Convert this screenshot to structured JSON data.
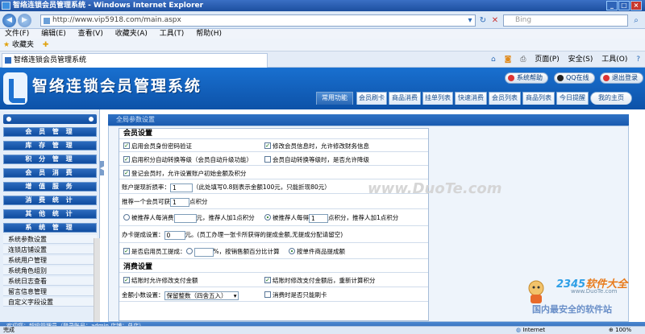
{
  "window": {
    "title": "智络连锁会员管理系统 - Windows Internet Explorer",
    "controls": [
      "_",
      "□",
      "×"
    ]
  },
  "addressbar": {
    "url": "http://www.vip5918.com/main.aspx",
    "search_placeholder": "Bing"
  },
  "menubar": {
    "items": [
      "文件(F)",
      "编辑(E)",
      "查看(V)",
      "收藏夹(A)",
      "工具(T)",
      "帮助(H)"
    ]
  },
  "favbar": {
    "label": "收藏夹"
  },
  "tab": {
    "label": "智络连锁会员管理系统"
  },
  "tabtools": {
    "items": [
      "页面(P)",
      "安全(S)",
      "工具(O)"
    ]
  },
  "app": {
    "title": "智络连锁会员管理系统"
  },
  "topbuttons": [
    "系统帮助",
    "QQ在线",
    "退出登录"
  ],
  "navtabs": {
    "items": [
      "常用功能",
      "会员刷卡",
      "商品消费",
      "挂单列表",
      "快速消费",
      "会员列表",
      "商品列表",
      "今日提醒",
      "我的主页"
    ],
    "active": 0
  },
  "sidebar": {
    "menus": [
      "会 员 管 理",
      "库 存 管 理",
      "积 分 管 理",
      "会 员 消 费",
      "增 值 服 务",
      "消 费 统 计",
      "其 他 统 计",
      "系 统 管 理"
    ],
    "subitems": [
      "系统参数设置",
      "连锁店铺设置",
      "系统用户管理",
      "系统角色组别",
      "系统日志查看",
      "留言信息管理",
      "自定义字段设置"
    ]
  },
  "main": {
    "header": "全局参数设置",
    "member_section": "会员设置",
    "r1a": "启用会员身份密码验证",
    "r1b": "修改会员信息时，允许修改财务信息",
    "r2a": "启用积分自动转换等级（会员自动升级功能）",
    "r2b": "会员自动转换等级时，是否允许降级",
    "r3": "登记会员时，允许设置账户初始金额及积分",
    "r4_label": "账户提现折损率：",
    "r4_value": "1",
    "r4_hint": "（此处填写0.8则表示金额100元，只能折现80元）",
    "r5_label": "推荐一个会员可获",
    "r5_value": "1",
    "r5_suffix": "点积分",
    "r6a_label": "被推荐人每消费",
    "r6a_suffix": "元，推荐人加1点积分",
    "r6b_label": "被推荐人每得",
    "r6b_value": "1",
    "r6b_suffix": "点积分，推荐人加1点积分",
    "r7_label": "办卡提成设置：",
    "r7_value": "0",
    "r7_hint": "元。(员工办理一张卡所获得的提成金额,无提成分配请留空)",
    "r8_label": "是否启用员工提成：",
    "r8_mid": "%，按销售额百分比计算",
    "r8_right": "按单件商品提成额",
    "consume_section": "消费设置",
    "c1a": "结账时允许修改支付金额",
    "c1b": "结账时修改支付金额后，重新计算积分",
    "c2_label": "金额小数设置：",
    "c2_value": "保留整数（四舍五入）",
    "c2b": "消费时是否只能刷卡"
  },
  "watermark": "www.DuoTe.com",
  "corner": {
    "brand": "2345",
    "brand_rest": "软件大全",
    "site": "www.DuoTe.com",
    "slogan": "国内最安全的软件站"
  },
  "statusinfo": "欢迎您：超级管理员（登录账号：admin 店铺：总店）",
  "statusbar": {
    "left": "完成",
    "zone": "Internet",
    "zoom": "100%"
  }
}
